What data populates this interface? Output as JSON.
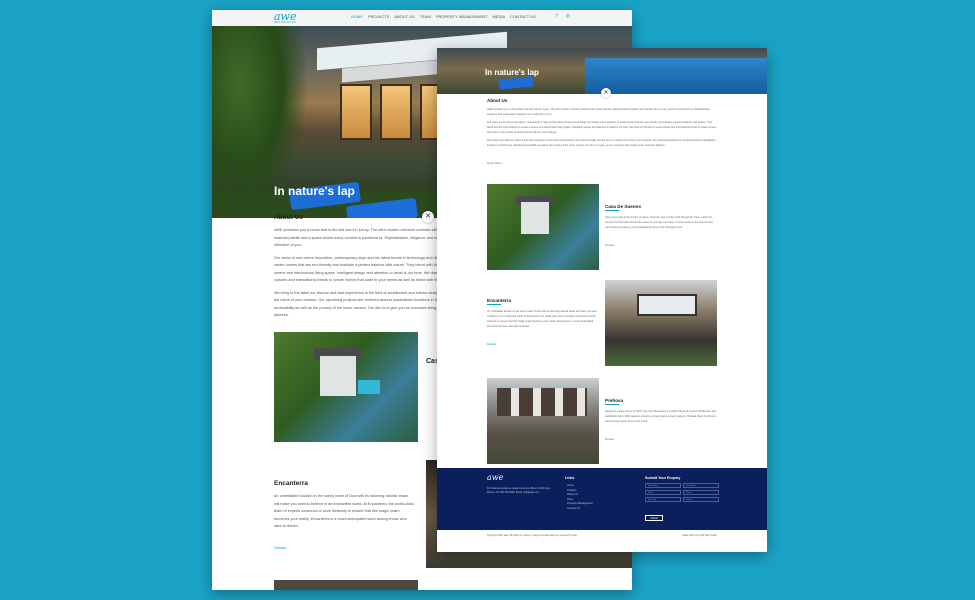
{
  "brand": {
    "logo": "awe",
    "tagline": "RESIDENCES"
  },
  "nav": {
    "items": [
      "HOME",
      "PROJECTS",
      "ABOUT US",
      "TEAM",
      "PROPERTY MANAGEMENT",
      "MEDIA",
      "CONTACT US"
    ],
    "active": "HOME"
  },
  "hero": {
    "title": "In nature's lap"
  },
  "about": {
    "title": "About Us",
    "p1": "AWE promises you a home that is the last word in luxury. The ultra modern exteriors combine with plush interiors, tasteful material palette and a space where every comfort is pandered to. Sophistication, elegance and understated grandeur are a reflection of you.",
    "p2": "Our vision is one where innovation, contemporary style and the latest trends in technology and design come together to create homes that are eco friendly and maintain a perfect balance with nature. They blend with the surroundings to create a serene and harmonious living space. Intelligent design and attention to detail is our forte. We draw on the best of local cultures and international trends to create homes that cater to your needs as well as blend with the surroundings.",
    "p3": "We bring to the table our diverse and vast experience in the field of architecture and interior design. We are here to conjure the home of your dreams. Our upcoming projects are centered around unparalleled locations in North Goa, following accessibility as well as the privacy of the home owners. Our aim is to give you an exclusive living space at an exclusive address.",
    "read_more": "Read More..."
  },
  "projects": {
    "casa": {
      "title": "Casa De Suenos",
      "text": "Open your heart to the rhythm of nature. Hear the sound of the wind through the trees, watch the sunrise over the fields and let the stress of your day melt away. A dream home in the heart of Goa, surrounded by greenery and breathtaking views of the Sinquerim river.",
      "details": "Details"
    },
    "encanterra": {
      "title": "Encanterra",
      "text": "An unbeatable location in the sunny heart of Goa with its stunning natural vistas will make you want to believe in an enchanted world. At Encanterra, the world-class team of experts continues to work tirelessly to ensure that this magic realm becomes your reality. Encanterra is a much-anticipated word among those who dare to dream.",
      "details": "Details"
    },
    "pretiosa": {
      "title": "Pretiosa",
      "text": "Nestled in a quiet corner of North Goa, this villa project is a perfect blend of modern architecture and traditional charm. With spacious interiors, private pools and lush gardens, Pretiosa offers the finest in contemporary living close to the beach.",
      "details": "Details"
    }
  },
  "footer": {
    "address": "For business enquiries contact us at our office in North Goa. Phone: +91 000 000 0000. Email: info@awe.com",
    "links_title": "Links",
    "links": [
      "Home",
      "Projects",
      "About Us",
      "Team",
      "Property Management",
      "Contact Us"
    ],
    "enquiry_title": "Submit Your Enquiry",
    "fields": [
      "First Name",
      "Last Name",
      "Email",
      "Phone",
      "Message",
      "Project"
    ],
    "submit": "Submit",
    "copyright": "Copyright 2021 awe. All rights for content, images and sitemaps are reserved by Awe.",
    "made_by": "Made with ♥ by Seiff Web Studio"
  },
  "colors": {
    "background": "#1aa3c6",
    "accent": "#0fa0c8",
    "footer": "#0a1f5c"
  }
}
